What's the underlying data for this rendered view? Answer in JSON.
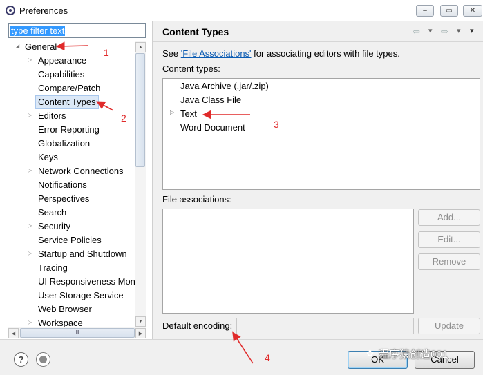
{
  "window": {
    "title": "Preferences",
    "minimize": "‒",
    "maximize": "▭",
    "close": "✕"
  },
  "left": {
    "filter_text": "type filter text",
    "tree": [
      {
        "label": "General",
        "level": 0,
        "expander": "◢"
      },
      {
        "label": "Appearance",
        "level": 1,
        "expander": "▷"
      },
      {
        "label": "Capabilities",
        "level": 1,
        "expander": ""
      },
      {
        "label": "Compare/Patch",
        "level": 1,
        "expander": ""
      },
      {
        "label": "Content Types",
        "level": 1,
        "expander": "",
        "selected": true
      },
      {
        "label": "Editors",
        "level": 1,
        "expander": "▷"
      },
      {
        "label": "Error Reporting",
        "level": 1,
        "expander": ""
      },
      {
        "label": "Globalization",
        "level": 1,
        "expander": ""
      },
      {
        "label": "Keys",
        "level": 1,
        "expander": ""
      },
      {
        "label": "Network Connections",
        "level": 1,
        "expander": "▷"
      },
      {
        "label": "Notifications",
        "level": 1,
        "expander": ""
      },
      {
        "label": "Perspectives",
        "level": 1,
        "expander": ""
      },
      {
        "label": "Search",
        "level": 1,
        "expander": ""
      },
      {
        "label": "Security",
        "level": 1,
        "expander": "▷"
      },
      {
        "label": "Service Policies",
        "level": 1,
        "expander": ""
      },
      {
        "label": "Startup and Shutdown",
        "level": 1,
        "expander": "▷"
      },
      {
        "label": "Tracing",
        "level": 1,
        "expander": ""
      },
      {
        "label": "UI Responsiveness Mon",
        "level": 1,
        "expander": ""
      },
      {
        "label": "User Storage Service",
        "level": 1,
        "expander": ""
      },
      {
        "label": "Web Browser",
        "level": 1,
        "expander": ""
      },
      {
        "label": "Workspace",
        "level": 1,
        "expander": "▷"
      }
    ]
  },
  "right": {
    "title": "Content Types",
    "nav": {
      "back": "⇦",
      "back_menu": "▾",
      "forward": "⇨",
      "forward_menu": "▾",
      "view_menu": "▾"
    },
    "assoc_prefix": "See ",
    "assoc_link": "'File Associations'",
    "assoc_suffix": " for associating editors with file types.",
    "content_types_label": "Content types:",
    "content_types": [
      {
        "label": "Java Archive (.jar/.zip)",
        "expander": ""
      },
      {
        "label": "Java Class File",
        "expander": ""
      },
      {
        "label": "Text",
        "expander": "▷"
      },
      {
        "label": "Word Document",
        "expander": ""
      }
    ],
    "file_assoc_label": "File associations:",
    "add_label": "Add...",
    "edit_label": "Edit...",
    "remove_label": "Remove",
    "encoding_label": "Default encoding:",
    "encoding_value": "",
    "update_label": "Update"
  },
  "footer": {
    "help": "?",
    "ok": "OK",
    "cancel": "Cancel"
  },
  "annotations": {
    "n1": "1",
    "n2": "2",
    "n3": "3",
    "n4": "4",
    "color": "#e02a2a"
  },
  "watermark": {
    "icon": "✿",
    "text": "程序猿创造001"
  }
}
